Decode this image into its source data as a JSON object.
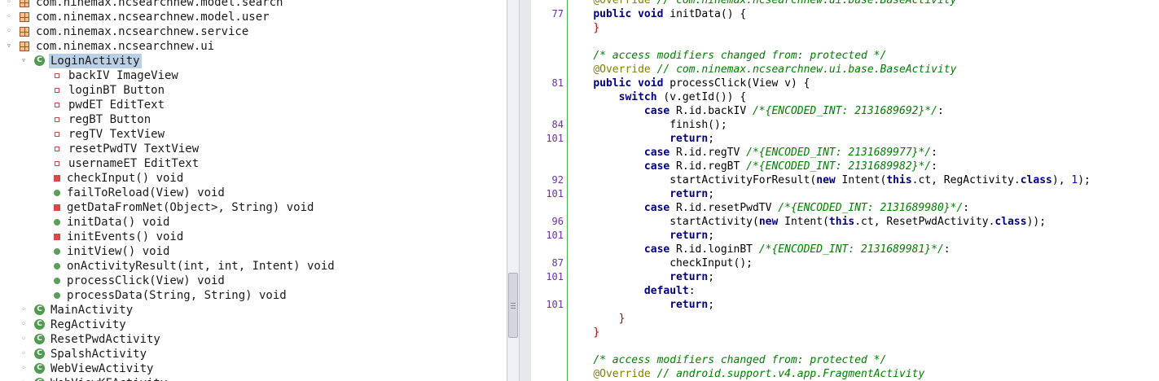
{
  "tree": {
    "items": [
      {
        "label": "com.ninemax.ncsearchnew.model.search",
        "kind": "package",
        "depth": 0
      },
      {
        "label": "com.ninemax.ncsearchnew.model.user",
        "kind": "package",
        "depth": 0
      },
      {
        "label": "com.ninemax.ncsearchnew.service",
        "kind": "package",
        "depth": 0
      },
      {
        "label": "com.ninemax.ncsearchnew.ui",
        "kind": "package",
        "depth": 0,
        "expanded": true
      },
      {
        "label": "LoginActivity",
        "kind": "class",
        "depth": 1,
        "expanded": true,
        "selected": true
      },
      {
        "label": "backIV ImageView",
        "kind": "field",
        "depth": 2
      },
      {
        "label": "loginBT Button",
        "kind": "field",
        "depth": 2
      },
      {
        "label": "pwdET EditText",
        "kind": "field",
        "depth": 2
      },
      {
        "label": "regBT Button",
        "kind": "field",
        "depth": 2
      },
      {
        "label": "regTV TextView",
        "kind": "field",
        "depth": 2
      },
      {
        "label": "resetPwdTV TextView",
        "kind": "field",
        "depth": 2
      },
      {
        "label": "usernameET EditText",
        "kind": "field",
        "depth": 2
      },
      {
        "label": "checkInput() void",
        "kind": "private-method",
        "depth": 2
      },
      {
        "label": "failToReload(View) void",
        "kind": "public-method",
        "depth": 2
      },
      {
        "label": "getDataFromNet(Object>, String) void",
        "kind": "private-method",
        "depth": 2
      },
      {
        "label": "initData() void",
        "kind": "public-method",
        "depth": 2
      },
      {
        "label": "initEvents() void",
        "kind": "private-method",
        "depth": 2
      },
      {
        "label": "initView() void",
        "kind": "public-method",
        "depth": 2
      },
      {
        "label": "onActivityResult(int, int, Intent) void",
        "kind": "public-method",
        "depth": 2
      },
      {
        "label": "processClick(View) void",
        "kind": "public-method",
        "depth": 2
      },
      {
        "label": "processData(String, String) void",
        "kind": "public-method",
        "depth": 2
      },
      {
        "label": "MainActivity",
        "kind": "class",
        "depth": 1
      },
      {
        "label": "RegActivity",
        "kind": "class",
        "depth": 1
      },
      {
        "label": "ResetPwdActivity",
        "kind": "class",
        "depth": 1
      },
      {
        "label": "SpalshActivity",
        "kind": "class",
        "depth": 1
      },
      {
        "label": "WebViewActivity",
        "kind": "class",
        "depth": 1
      },
      {
        "label": "WebViewKFActivity",
        "kind": "class",
        "depth": 1
      }
    ],
    "class_icon_letter": "C"
  },
  "code": {
    "lines": [
      {
        "ln": "",
        "segs": [
          {
            "t": "    "
          },
          {
            "t": "@Override",
            "c": "an"
          },
          {
            "t": " "
          },
          {
            "t": "// com.ninemax.ncsearchnew.ui.base.BaseActivity",
            "c": "cm"
          }
        ]
      },
      {
        "ln": "77",
        "segs": [
          {
            "t": "    "
          },
          {
            "t": "public",
            "c": "kw"
          },
          {
            "t": " "
          },
          {
            "t": "void",
            "c": "kw"
          },
          {
            "t": " initData() {"
          }
        ]
      },
      {
        "ln": "",
        "segs": [
          {
            "t": "    "
          },
          {
            "t": "}",
            "c": "br"
          }
        ]
      },
      {
        "ln": "",
        "segs": []
      },
      {
        "ln": "",
        "segs": [
          {
            "t": "    "
          },
          {
            "t": "/* access modifiers changed from: protected */",
            "c": "cm"
          }
        ]
      },
      {
        "ln": "",
        "segs": [
          {
            "t": "    "
          },
          {
            "t": "@Override",
            "c": "an"
          },
          {
            "t": " "
          },
          {
            "t": "// com.ninemax.ncsearchnew.ui.base.BaseActivity",
            "c": "cm"
          }
        ]
      },
      {
        "ln": "81",
        "segs": [
          {
            "t": "    "
          },
          {
            "t": "public",
            "c": "kw"
          },
          {
            "t": " "
          },
          {
            "t": "void",
            "c": "kw"
          },
          {
            "t": " processClick(View v) {"
          }
        ]
      },
      {
        "ln": "",
        "segs": [
          {
            "t": "        "
          },
          {
            "t": "switch",
            "c": "kw"
          },
          {
            "t": " (v.getId()) {"
          }
        ]
      },
      {
        "ln": "",
        "segs": [
          {
            "t": "            "
          },
          {
            "t": "case",
            "c": "kw"
          },
          {
            "t": " R.id.backIV "
          },
          {
            "t": "/*{ENCODED_INT: 2131689692}*/",
            "c": "cm"
          },
          {
            "t": ":"
          }
        ]
      },
      {
        "ln": "84",
        "segs": [
          {
            "t": "                finish();"
          }
        ]
      },
      {
        "ln": "101",
        "segs": [
          {
            "t": "                "
          },
          {
            "t": "return",
            "c": "kw"
          },
          {
            "t": ";"
          }
        ]
      },
      {
        "ln": "",
        "segs": [
          {
            "t": "            "
          },
          {
            "t": "case",
            "c": "kw"
          },
          {
            "t": " R.id.regTV "
          },
          {
            "t": "/*{ENCODED_INT: 2131689977}*/",
            "c": "cm"
          },
          {
            "t": ":"
          }
        ]
      },
      {
        "ln": "",
        "segs": [
          {
            "t": "            "
          },
          {
            "t": "case",
            "c": "kw"
          },
          {
            "t": " R.id.regBT "
          },
          {
            "t": "/*{ENCODED_INT: 2131689982}*/",
            "c": "cm"
          },
          {
            "t": ":"
          }
        ]
      },
      {
        "ln": "92",
        "segs": [
          {
            "t": "                startActivityForResult("
          },
          {
            "t": "new",
            "c": "kw"
          },
          {
            "t": " Intent("
          },
          {
            "t": "this",
            "c": "kw"
          },
          {
            "t": ".ct, RegActivity."
          },
          {
            "t": "class",
            "c": "kw"
          },
          {
            "t": "), "
          },
          {
            "t": "1",
            "c": "num"
          },
          {
            "t": ");"
          }
        ]
      },
      {
        "ln": "101",
        "segs": [
          {
            "t": "                "
          },
          {
            "t": "return",
            "c": "kw"
          },
          {
            "t": ";"
          }
        ]
      },
      {
        "ln": "",
        "segs": [
          {
            "t": "            "
          },
          {
            "t": "case",
            "c": "kw"
          },
          {
            "t": " R.id.resetPwdTV "
          },
          {
            "t": "/*{ENCODED_INT: 2131689980}*/",
            "c": "cm"
          },
          {
            "t": ":"
          }
        ]
      },
      {
        "ln": "96",
        "segs": [
          {
            "t": "                startActivity("
          },
          {
            "t": "new",
            "c": "kw"
          },
          {
            "t": " Intent("
          },
          {
            "t": "this",
            "c": "kw"
          },
          {
            "t": ".ct, ResetPwdActivity."
          },
          {
            "t": "class",
            "c": "kw"
          },
          {
            "t": "));"
          }
        ]
      },
      {
        "ln": "101",
        "segs": [
          {
            "t": "                "
          },
          {
            "t": "return",
            "c": "kw"
          },
          {
            "t": ";"
          }
        ]
      },
      {
        "ln": "",
        "segs": [
          {
            "t": "            "
          },
          {
            "t": "case",
            "c": "kw"
          },
          {
            "t": " R.id.loginBT "
          },
          {
            "t": "/*{ENCODED_INT: 2131689981}*/",
            "c": "cm"
          },
          {
            "t": ":"
          }
        ]
      },
      {
        "ln": "87",
        "segs": [
          {
            "t": "                checkInput();"
          }
        ]
      },
      {
        "ln": "101",
        "segs": [
          {
            "t": "                "
          },
          {
            "t": "return",
            "c": "kw"
          },
          {
            "t": ";"
          }
        ]
      },
      {
        "ln": "",
        "segs": [
          {
            "t": "            "
          },
          {
            "t": "default",
            "c": "kw"
          },
          {
            "t": ":"
          }
        ]
      },
      {
        "ln": "101",
        "segs": [
          {
            "t": "                "
          },
          {
            "t": "return",
            "c": "kw"
          },
          {
            "t": ";"
          }
        ]
      },
      {
        "ln": "",
        "segs": [
          {
            "t": "        "
          },
          {
            "t": "}",
            "c": "br"
          }
        ]
      },
      {
        "ln": "",
        "segs": [
          {
            "t": "    "
          },
          {
            "t": "}",
            "c": "br"
          }
        ]
      },
      {
        "ln": "",
        "segs": []
      },
      {
        "ln": "",
        "segs": [
          {
            "t": "    "
          },
          {
            "t": "/* access modifiers changed from: protected */",
            "c": "cm"
          }
        ]
      },
      {
        "ln": "",
        "segs": [
          {
            "t": "    "
          },
          {
            "t": "@Override",
            "c": "an"
          },
          {
            "t": " "
          },
          {
            "t": "// android.support.v4.app.FragmentActivity",
            "c": "cm"
          }
        ]
      }
    ]
  }
}
